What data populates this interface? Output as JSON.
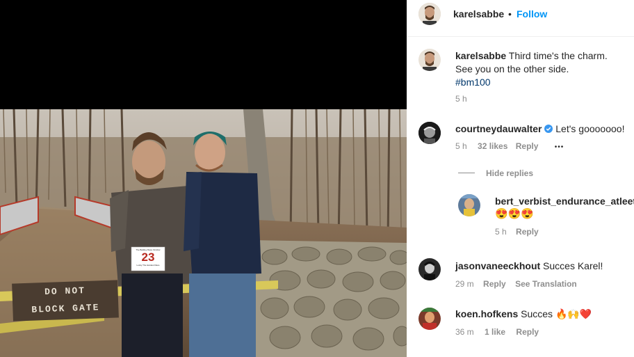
{
  "post": {
    "bib_number": "23",
    "bib_header": "The Barkley Race Finisher",
    "bib_footer": "Lucky The Hardest Race",
    "sign_line1": "DO NOT",
    "sign_line2": "BLOCK GATE"
  },
  "header": {
    "username": "karelsabbe",
    "separator": "•",
    "follow_label": "Follow"
  },
  "caption": {
    "username": "karelsabbe",
    "line1": " Third time's the charm.",
    "line2": "See you on the other side.",
    "hashtag": "#bm100",
    "time": "5 h"
  },
  "comments": [
    {
      "username": "courtneydauwalter",
      "verified": true,
      "text": " Let's gooooooo!",
      "time": "5 h",
      "likes": "32 likes",
      "reply": "Reply",
      "more": "•••",
      "hide_replies": "Hide replies"
    },
    {
      "username": "bert_verbist_endurance_atleet",
      "text": "😍😍😍",
      "time": "5 h",
      "reply": "Reply"
    },
    {
      "username": "jasonvaneeckhout",
      "text": " Succes Karel!",
      "time": "29 m",
      "reply": "Reply",
      "translate": "See Translation"
    },
    {
      "username": "koen.hofkens",
      "text": " Succes 🔥🙌❤️",
      "time": "36 m",
      "likes": "1 like",
      "reply": "Reply"
    }
  ],
  "colors": {
    "accent": "#0095f6",
    "verified": "#3897f0",
    "text": "#262626",
    "secondary": "#8e8e8e"
  }
}
